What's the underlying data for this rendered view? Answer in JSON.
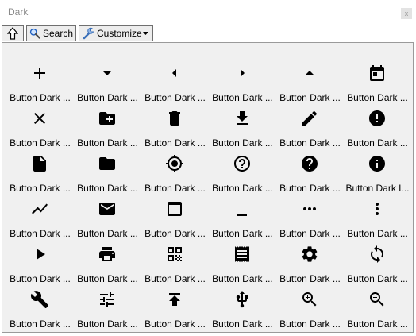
{
  "window": {
    "title": "Dark",
    "close_glyph": "x"
  },
  "toolbar": {
    "search_label": "Search",
    "customize_label": "Customize"
  },
  "grid": [
    {
      "label": "Button Dark ...",
      "icon": "add-icon"
    },
    {
      "label": "Button Dark ...",
      "icon": "arrow-drop-down-icon"
    },
    {
      "label": "Button Dark ...",
      "icon": "arrow-left-icon"
    },
    {
      "label": "Button Dark ...",
      "icon": "arrow-right-icon"
    },
    {
      "label": "Button Dark ...",
      "icon": "arrow-drop-up-icon"
    },
    {
      "label": "Button Dark ...",
      "icon": "calendar-icon"
    },
    {
      "label": "Button Dark ...",
      "icon": "close-icon"
    },
    {
      "label": "Button Dark ...",
      "icon": "create-folder-icon"
    },
    {
      "label": "Button Dark ...",
      "icon": "delete-icon"
    },
    {
      "label": "Button Dark ...",
      "icon": "download-icon"
    },
    {
      "label": "Button Dark ...",
      "icon": "edit-icon"
    },
    {
      "label": "Button Dark ...",
      "icon": "error-icon"
    },
    {
      "label": "Button Dark ...",
      "icon": "file-icon"
    },
    {
      "label": "Button Dark ...",
      "icon": "folder-icon"
    },
    {
      "label": "Button Dark ...",
      "icon": "gps-icon"
    },
    {
      "label": "Button Dark ...",
      "icon": "help-outline-icon"
    },
    {
      "label": "Button Dark ...",
      "icon": "help-icon"
    },
    {
      "label": "Button Dark I...",
      "icon": "info-icon"
    },
    {
      "label": "Button Dark ...",
      "icon": "trending-icon"
    },
    {
      "label": "Button Dark ...",
      "icon": "mail-icon"
    },
    {
      "label": "Button Dark ...",
      "icon": "maximize-icon"
    },
    {
      "label": "Button Dark ...",
      "icon": "minimize-icon"
    },
    {
      "label": "Button Dark ...",
      "icon": "more-horizontal-icon"
    },
    {
      "label": "Button Dark ...",
      "icon": "more-vertical-icon"
    },
    {
      "label": "Button Dark ...",
      "icon": "play-icon"
    },
    {
      "label": "Button Dark ...",
      "icon": "print-icon"
    },
    {
      "label": "Button Dark ...",
      "icon": "qr-code-icon"
    },
    {
      "label": "Button Dark ...",
      "icon": "receipt-icon"
    },
    {
      "label": "Button Dark ...",
      "icon": "settings-icon"
    },
    {
      "label": "Button Dark ...",
      "icon": "sync-icon"
    },
    {
      "label": "Button Dark ...",
      "icon": "wrench-icon"
    },
    {
      "label": "Button Dark ...",
      "icon": "tune-icon"
    },
    {
      "label": "Button Dark ...",
      "icon": "upload-icon"
    },
    {
      "label": "Button Dark ...",
      "icon": "usb-icon"
    },
    {
      "label": "Button Dark ...",
      "icon": "zoom-in-icon"
    },
    {
      "label": "Button Dark ...",
      "icon": "zoom-out-icon"
    }
  ]
}
